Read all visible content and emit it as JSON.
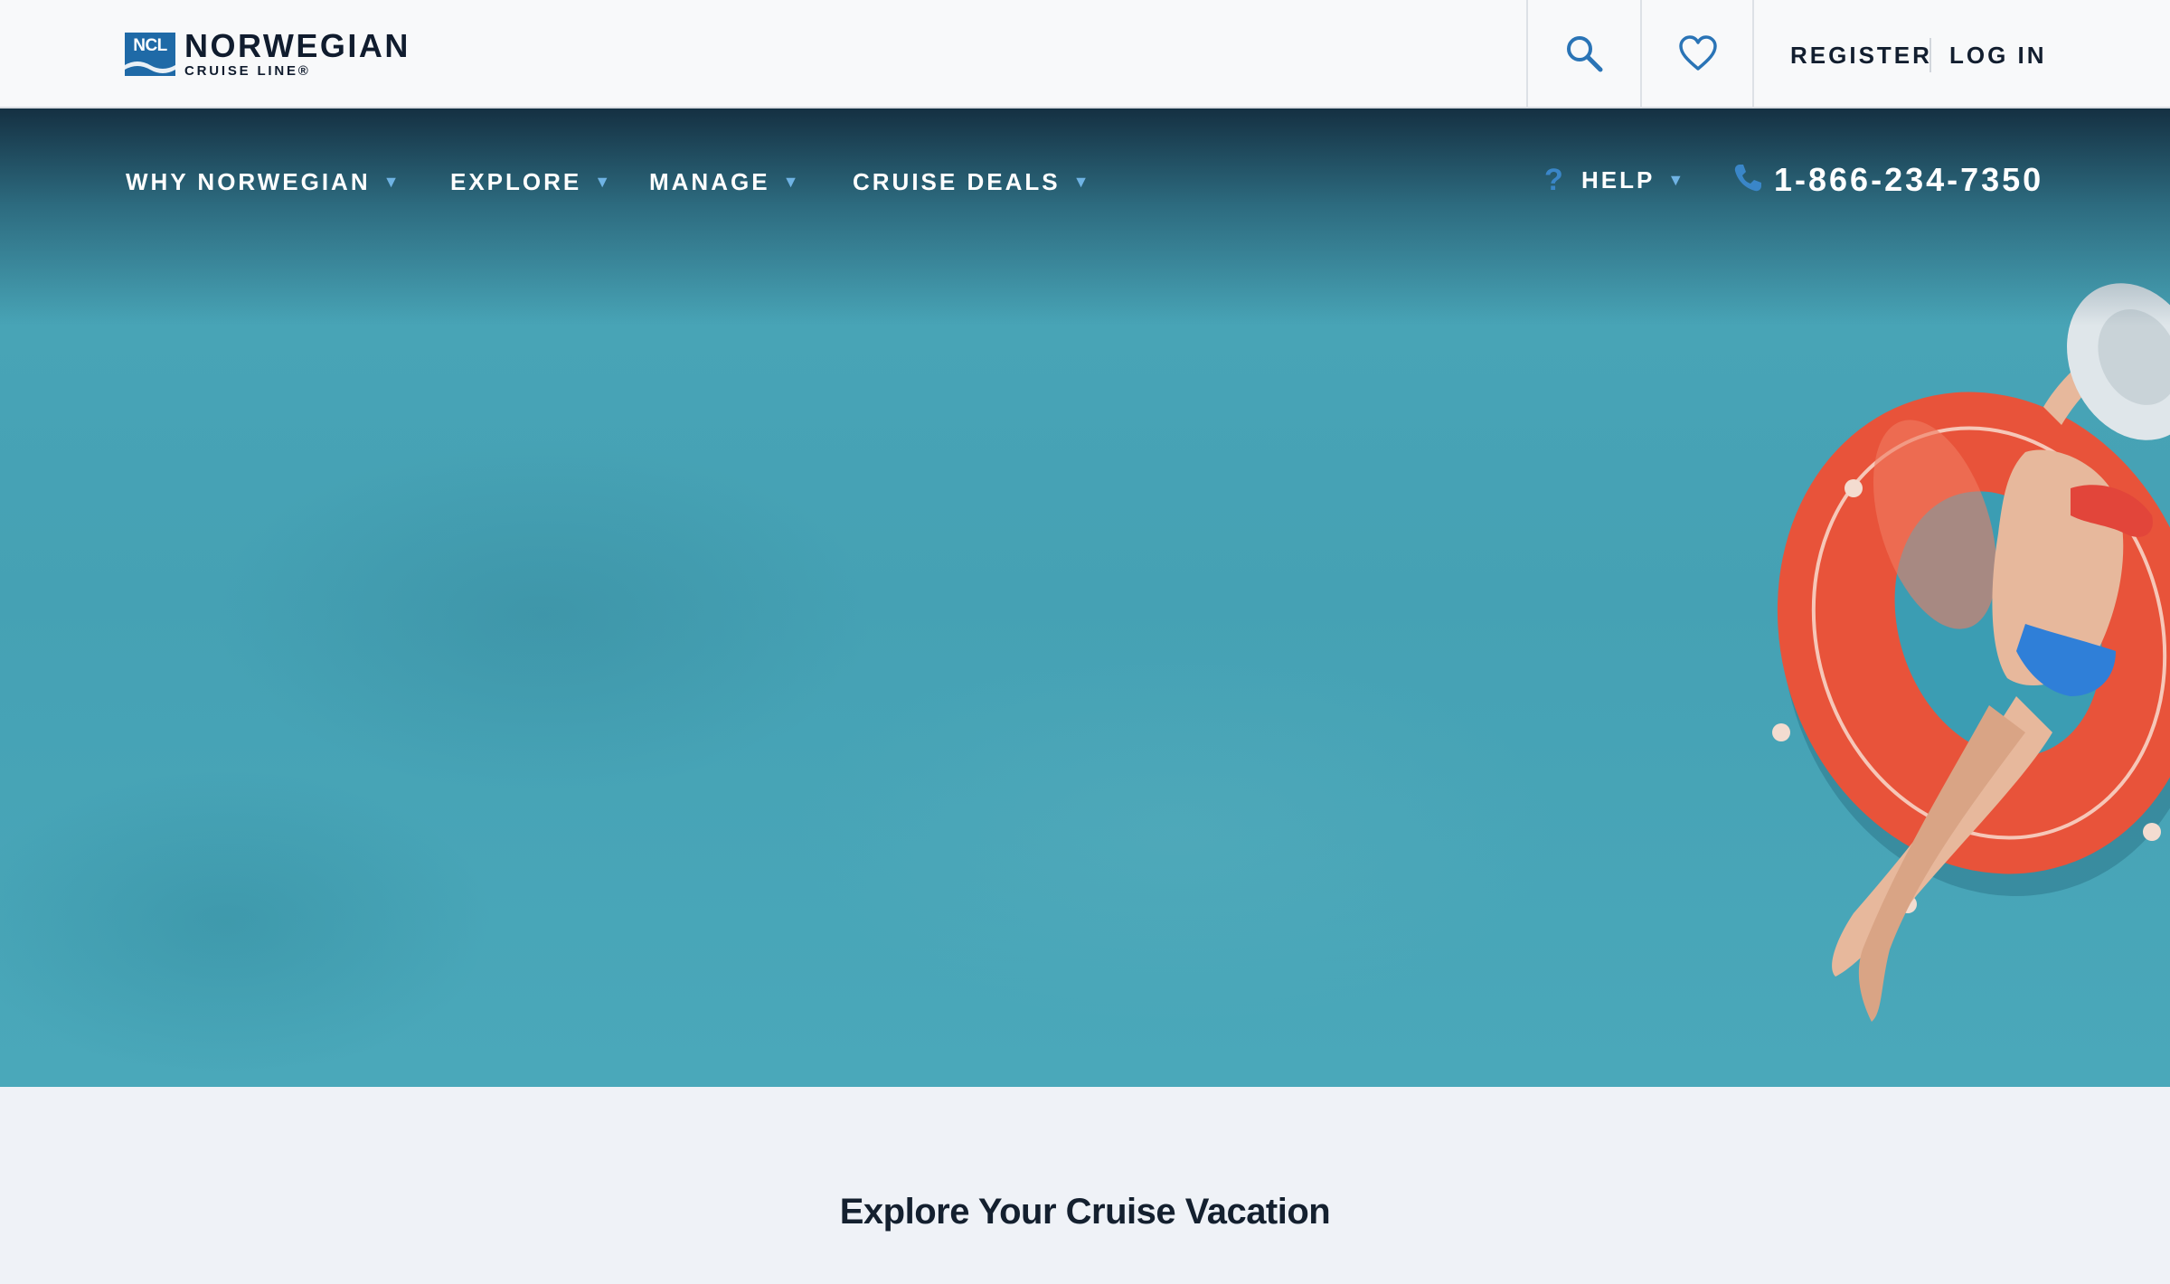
{
  "brand": {
    "badge_text": "NCL",
    "name": "NORWEGIAN",
    "subtitle": "CRUISE LINE®",
    "color": "#1f6aa7"
  },
  "header": {
    "search_icon": "search-icon",
    "favorites_icon": "heart-icon",
    "register_label": "REGISTER",
    "login_label": "LOG IN"
  },
  "nav": {
    "items": [
      {
        "label": "WHY NORWEGIAN"
      },
      {
        "label": "EXPLORE"
      },
      {
        "label": "MANAGE"
      },
      {
        "label": "CRUISE DEALS"
      }
    ],
    "caret": "▼",
    "help_mark": "?",
    "help_label": "HELP",
    "phone_icon": "phone-icon",
    "phone_number": "1-866-234-7350",
    "accent": "#3a86c8"
  },
  "hero": {
    "water_color": "#4aa6b8",
    "float_color": "#e8533a"
  },
  "section": {
    "title": "Explore Your Cruise Vacation"
  }
}
